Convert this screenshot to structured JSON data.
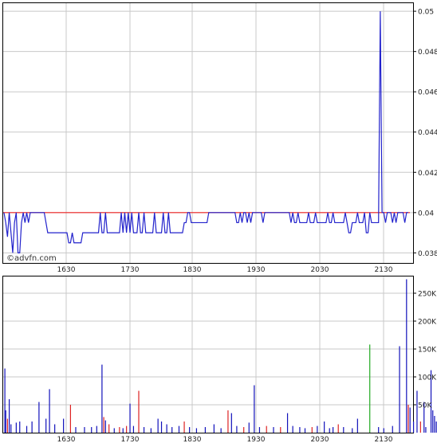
{
  "watermark": "©advfn.com",
  "colors": {
    "price_line": "#2222cc",
    "reference_line": "#ee2222",
    "volume_up": "#1111bb",
    "volume_down": "#dd2222",
    "volume_neutral": "#22aa22",
    "grid": "#c8c8c8"
  },
  "chart_data": [
    {
      "type": "line",
      "panel": "price",
      "title": "",
      "xlabel": "",
      "ylabel": "",
      "x_ticks": [
        "1630",
        "1730",
        "1830",
        "1930",
        "2030",
        "2130"
      ],
      "y_ticks": [
        "0.05",
        "0.048",
        "0.046",
        "0.044",
        "0.042",
        "0.04",
        "0.038"
      ],
      "ylim": [
        0.0375,
        0.0504
      ],
      "grid": true,
      "y_axis_position": "right",
      "reference_line": {
        "value": 0.04,
        "color": "#ee2222"
      },
      "series": [
        {
          "values": [
            0.04,
            0.0395,
            0.0388,
            0.04,
            0.039,
            0.038,
            0.0395,
            0.04,
            0.038,
            0.038,
            0.0395,
            0.04,
            0.0395,
            0.04,
            0.0395,
            0.04,
            0.04,
            0.04,
            0.04,
            0.04,
            0.04,
            0.04,
            0.04,
            0.04,
            0.0395,
            0.039,
            0.039,
            0.039,
            0.039,
            0.039,
            0.039,
            0.039,
            0.039,
            0.039,
            0.039,
            0.039,
            0.039,
            0.0385,
            0.0385,
            0.039,
            0.0385,
            0.0385,
            0.0385,
            0.0385,
            0.0385,
            0.039,
            0.039,
            0.039,
            0.039,
            0.039,
            0.039,
            0.039,
            0.039,
            0.039,
            0.039,
            0.04,
            0.039,
            0.039,
            0.04,
            0.039,
            0.039,
            0.039,
            0.039,
            0.039,
            0.039,
            0.039,
            0.039,
            0.04,
            0.039,
            0.04,
            0.039,
            0.04,
            0.039,
            0.04,
            0.039,
            0.039,
            0.039,
            0.04,
            0.039,
            0.039,
            0.04,
            0.039,
            0.039,
            0.039,
            0.039,
            0.039,
            0.04,
            0.039,
            0.039,
            0.039,
            0.039,
            0.04,
            0.039,
            0.039,
            0.04,
            0.039,
            0.039,
            0.039,
            0.039,
            0.039,
            0.039,
            0.039,
            0.039,
            0.0395,
            0.0395,
            0.04,
            0.04,
            0.0395,
            0.0395,
            0.0395,
            0.0395,
            0.0395,
            0.0395,
            0.0395,
            0.0395,
            0.0395,
            0.0395,
            0.04,
            0.04,
            0.04,
            0.04,
            0.04,
            0.04,
            0.04,
            0.04,
            0.04,
            0.04,
            0.04,
            0.04,
            0.04,
            0.04,
            0.04,
            0.04,
            0.0395,
            0.0395,
            0.04,
            0.0395,
            0.04,
            0.04,
            0.0395,
            0.04,
            0.0395,
            0.04,
            0.04,
            0.04,
            0.04,
            0.04,
            0.04,
            0.0395,
            0.04,
            0.04,
            0.04,
            0.04,
            0.04,
            0.04,
            0.04,
            0.04,
            0.04,
            0.04,
            0.04,
            0.04,
            0.04,
            0.04,
            0.04,
            0.0395,
            0.04,
            0.0395,
            0.0395,
            0.04,
            0.0395,
            0.0395,
            0.0395,
            0.0395,
            0.0395,
            0.04,
            0.0395,
            0.0395,
            0.0395,
            0.04,
            0.0395,
            0.0395,
            0.0395,
            0.0395,
            0.0395,
            0.0395,
            0.04,
            0.0395,
            0.0395,
            0.04,
            0.0395,
            0.0395,
            0.0395,
            0.0395,
            0.0395,
            0.0395,
            0.04,
            0.0395,
            0.039,
            0.039,
            0.0395,
            0.0395,
            0.0395,
            0.04,
            0.0395,
            0.0395,
            0.0395,
            0.04,
            0.039,
            0.039,
            0.04,
            0.0395,
            0.0395,
            0.0395,
            0.0395,
            0.0395,
            0.05,
            0.04,
            0.04,
            0.0395,
            0.04,
            0.04,
            0.04,
            0.0395,
            0.04,
            0.0395,
            0.04,
            0.04,
            0.04,
            0.04,
            0.0395,
            0.04,
            0.04
          ]
        }
      ]
    },
    {
      "type": "bar",
      "panel": "volume",
      "title": "",
      "xlabel": "",
      "ylabel": "",
      "x_ticks": [
        "1630",
        "1730",
        "1830",
        "1930",
        "2030",
        "2130"
      ],
      "y_ticks": [
        "250K",
        "200K",
        "150K",
        "100K",
        "50K"
      ],
      "ylim": [
        0,
        280000
      ],
      "grid": true,
      "y_axis_position": "right",
      "bars": [
        {
          "x": 0.5,
          "v": 115000,
          "c": "up"
        },
        {
          "x": 1,
          "v": 40000,
          "c": "up"
        },
        {
          "x": 2,
          "v": 25000,
          "c": "down"
        },
        {
          "x": 3,
          "v": 60000,
          "c": "up"
        },
        {
          "x": 4,
          "v": 15000,
          "c": "up"
        },
        {
          "x": 7,
          "v": 18000,
          "c": "up"
        },
        {
          "x": 9,
          "v": 20000,
          "c": "up"
        },
        {
          "x": 13,
          "v": 12000,
          "c": "up"
        },
        {
          "x": 16,
          "v": 20000,
          "c": "up"
        },
        {
          "x": 20,
          "v": 55000,
          "c": "up"
        },
        {
          "x": 24,
          "v": 25000,
          "c": "up"
        },
        {
          "x": 26,
          "v": 78000,
          "c": "up"
        },
        {
          "x": 29,
          "v": 15000,
          "c": "up"
        },
        {
          "x": 34,
          "v": 25000,
          "c": "up"
        },
        {
          "x": 38,
          "v": 50000,
          "c": "down"
        },
        {
          "x": 41,
          "v": 10000,
          "c": "up"
        },
        {
          "x": 46,
          "v": 10000,
          "c": "up"
        },
        {
          "x": 50,
          "v": 10000,
          "c": "up"
        },
        {
          "x": 53,
          "v": 12000,
          "c": "up"
        },
        {
          "x": 56,
          "v": 122000,
          "c": "up"
        },
        {
          "x": 57,
          "v": 28000,
          "c": "down"
        },
        {
          "x": 58,
          "v": 22000,
          "c": "up"
        },
        {
          "x": 60,
          "v": 15000,
          "c": "down"
        },
        {
          "x": 63,
          "v": 8000,
          "c": "up"
        },
        {
          "x": 66,
          "v": 10000,
          "c": "down"
        },
        {
          "x": 68,
          "v": 8000,
          "c": "up"
        },
        {
          "x": 70,
          "v": 12000,
          "c": "down"
        },
        {
          "x": 72,
          "v": 52000,
          "c": "up"
        },
        {
          "x": 74,
          "v": 12000,
          "c": "up"
        },
        {
          "x": 77,
          "v": 75000,
          "c": "down"
        },
        {
          "x": 80,
          "v": 10000,
          "c": "up"
        },
        {
          "x": 84,
          "v": 8000,
          "c": "up"
        },
        {
          "x": 88,
          "v": 25000,
          "c": "up"
        },
        {
          "x": 90,
          "v": 20000,
          "c": "up"
        },
        {
          "x": 93,
          "v": 15000,
          "c": "up"
        },
        {
          "x": 96,
          "v": 10000,
          "c": "up"
        },
        {
          "x": 100,
          "v": 12000,
          "c": "up"
        },
        {
          "x": 103,
          "v": 20000,
          "c": "down"
        },
        {
          "x": 106,
          "v": 10000,
          "c": "up"
        },
        {
          "x": 110,
          "v": 8000,
          "c": "up"
        },
        {
          "x": 115,
          "v": 10000,
          "c": "up"
        },
        {
          "x": 120,
          "v": 15000,
          "c": "up"
        },
        {
          "x": 124,
          "v": 8000,
          "c": "up"
        },
        {
          "x": 128,
          "v": 40000,
          "c": "down"
        },
        {
          "x": 130,
          "v": 35000,
          "c": "up"
        },
        {
          "x": 133,
          "v": 12000,
          "c": "up"
        },
        {
          "x": 137,
          "v": 10000,
          "c": "down"
        },
        {
          "x": 140,
          "v": 18000,
          "c": "up"
        },
        {
          "x": 143,
          "v": 85000,
          "c": "up"
        },
        {
          "x": 146,
          "v": 10000,
          "c": "up"
        },
        {
          "x": 150,
          "v": 12000,
          "c": "down"
        },
        {
          "x": 154,
          "v": 10000,
          "c": "up"
        },
        {
          "x": 158,
          "v": 10000,
          "c": "down"
        },
        {
          "x": 162,
          "v": 35000,
          "c": "up"
        },
        {
          "x": 165,
          "v": 12000,
          "c": "up"
        },
        {
          "x": 169,
          "v": 10000,
          "c": "up"
        },
        {
          "x": 172,
          "v": 8000,
          "c": "up"
        },
        {
          "x": 176,
          "v": 10000,
          "c": "down"
        },
        {
          "x": 179,
          "v": 12000,
          "c": "up"
        },
        {
          "x": 183,
          "v": 20000,
          "c": "up"
        },
        {
          "x": 186,
          "v": 8000,
          "c": "up"
        },
        {
          "x": 188,
          "v": 10000,
          "c": "up"
        },
        {
          "x": 191,
          "v": 15000,
          "c": "down"
        },
        {
          "x": 194,
          "v": 10000,
          "c": "up"
        },
        {
          "x": 199,
          "v": 8000,
          "c": "up"
        },
        {
          "x": 202,
          "v": 25000,
          "c": "up"
        },
        {
          "x": 209,
          "v": 158000,
          "c": "neutral"
        },
        {
          "x": 214,
          "v": 10000,
          "c": "up"
        },
        {
          "x": 217,
          "v": 8000,
          "c": "up"
        },
        {
          "x": 222,
          "v": 12000,
          "c": "up"
        },
        {
          "x": 226,
          "v": 155000,
          "c": "up"
        },
        {
          "x": 230,
          "v": 275000,
          "c": "up"
        },
        {
          "x": 231,
          "v": 50000,
          "c": "down"
        },
        {
          "x": 232,
          "v": 45000,
          "c": "up"
        },
        {
          "x": 234,
          "v": 20000,
          "c": "up"
        },
        {
          "x": 236,
          "v": 75000,
          "c": "up"
        },
        {
          "x": 238,
          "v": 20000,
          "c": "down"
        },
        {
          "x": 240,
          "v": 55000,
          "c": "up"
        },
        {
          "x": 241,
          "v": 10000,
          "c": "up"
        },
        {
          "x": 244,
          "v": 112000,
          "c": "up"
        },
        {
          "x": 245,
          "v": 40000,
          "c": "up"
        },
        {
          "x": 246,
          "v": 30000,
          "c": "up"
        },
        {
          "x": 247,
          "v": 20000,
          "c": "up"
        },
        {
          "x": 248,
          "v": 130000,
          "c": "up"
        },
        {
          "x": 249,
          "v": 35000,
          "c": "up"
        },
        {
          "x": 251,
          "v": 25000,
          "c": "up"
        }
      ]
    }
  ]
}
